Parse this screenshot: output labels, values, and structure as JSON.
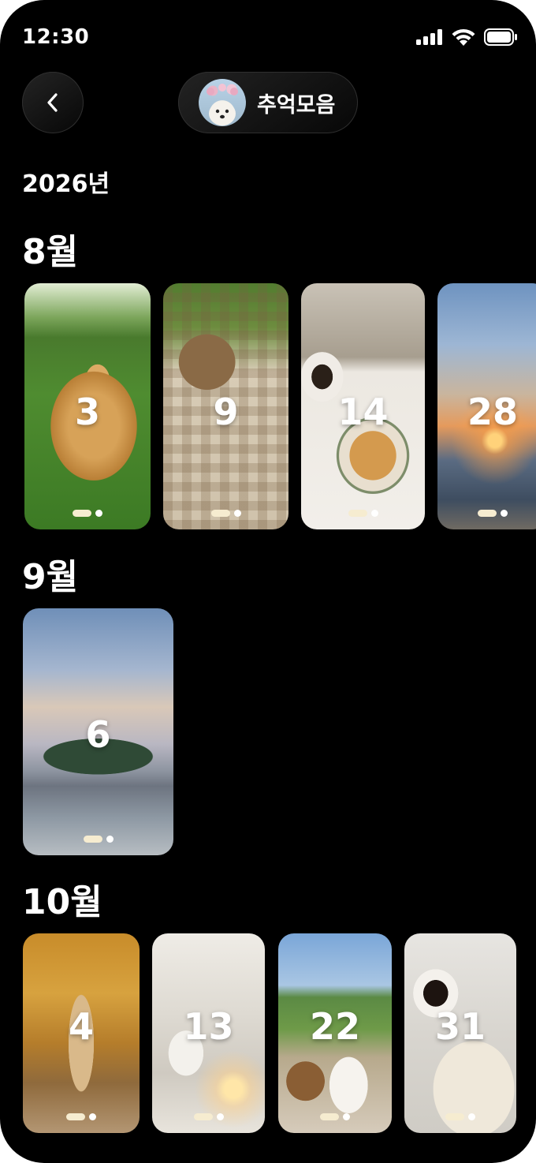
{
  "status": {
    "time": "12:30"
  },
  "header": {
    "album_title": "추억모음"
  },
  "year_label": "2026년",
  "months": [
    {
      "label": "8월",
      "days": [
        "3",
        "9",
        "14",
        "28"
      ]
    },
    {
      "label": "9월",
      "days": [
        "6"
      ]
    },
    {
      "label": "10월",
      "days": [
        "4",
        "13",
        "22",
        "31"
      ]
    }
  ]
}
